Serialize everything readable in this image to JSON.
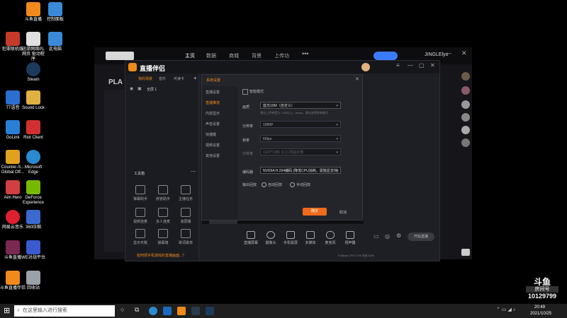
{
  "desktop": {
    "icons_left": [
      {
        "label": "",
        "color": "#f08a1c"
      },
      {
        "label": "犯罪联机版",
        "color": "#c53a2a"
      },
      {
        "label": "Steam",
        "color": "#1b3a5c"
      },
      {
        "label": "TT语音",
        "color": "#2a6fd0"
      },
      {
        "label": "GoLink",
        "color": "#2a7fd8"
      },
      {
        "label": "Counter-S... Global Off...",
        "color": "#e0a020"
      },
      {
        "label": "Aim Hero",
        "color": "#d04040"
      },
      {
        "label": "网易云音乐",
        "color": "#e02030"
      },
      {
        "label": "斗鱼直播",
        "color": "#7a2a50"
      },
      {
        "label": "斗鱼直播伴侣",
        "color": "#f08a1c"
      }
    ],
    "icons_right": [
      {
        "label": "控制面板",
        "color": "#3a8ad8"
      },
      {
        "label": "迅游网络PL网页 驱动程序",
        "color": "#e0e0e0"
      },
      {
        "label": "此电脑",
        "color": "#3a8ad8"
      },
      {
        "label": "Sound Lock",
        "color": "#e0b040"
      },
      {
        "label": "Riot Client",
        "color": "#d03030"
      },
      {
        "label": "Microsoft Edge",
        "color": "#2a8ad0"
      },
      {
        "label": "GeForce Experience",
        "color": "#76b900"
      },
      {
        "label": "360压缩",
        "color": "#3a6ad0"
      },
      {
        "label": "WE对战平台",
        "color": "#3a5ad0"
      },
      {
        "label": "回收站",
        "color": "#9aa0a8"
      }
    ],
    "top_left_label": "斗鱼直播"
  },
  "taskbar": {
    "search_placeholder": "在这里输入进行搜索",
    "time": "20:49",
    "date": "2021/10/25"
  },
  "watermark": {
    "brand": "斗鱼",
    "subtitle": "房间号",
    "room": "10129799"
  },
  "back_window": {
    "nav": [
      "主页",
      "数据",
      "商城",
      "背景",
      "上传功"
    ],
    "user": "JINGLElyo",
    "play_label": "PLA",
    "accent": "#3a7bff"
  },
  "studio": {
    "logo": "直播伴侣",
    "tabs": [
      "我的场景",
      "音乐",
      "可读卡"
    ],
    "scene_item": "全屏 1",
    "tools_header": "工具箱",
    "tools": [
      "弹幕助手",
      "房管助手",
      "主播任务",
      "视频连麦",
      "多人连麦",
      "滚屏播",
      "显示天赋",
      "弹幕墙",
      "歌词歌单"
    ],
    "footer_tip": "如何把手机游戏的直播画面...?",
    "bottom_buttons": [
      "直播屏幕",
      "摄像头",
      "手机投屏",
      "多媒体",
      "麦克风",
      "扬声器"
    ],
    "start_button": "开始直播",
    "status_text": "0.0kbps  CPU 17%  内存 62%"
  },
  "dialog": {
    "title": "系统设置",
    "sidebar": [
      "直播设置",
      "直播推流",
      "内容显示",
      "声音设置",
      "快捷键",
      "视频设置",
      "其他设置"
    ],
    "checkbox_label": "智能模式",
    "rows": [
      {
        "label": "画质",
        "value": "蓝光10M（自定义）"
      },
      {
        "label": "分辨率",
        "value": "1080P"
      },
      {
        "label": "帧率",
        "value": "60fps"
      },
      {
        "label": "分辨率",
        "value": "1920*1080 (1:1) 原始比例"
      },
      {
        "label": "编码器",
        "value": "NVIDIA H.264编码 (降低CPU消耗，需独显支持)"
      }
    ],
    "hint": "建议上传带宽为: 10M以上，Mbps，建议选择智能模式",
    "output_label": "输出回放",
    "radio_a": "自动回放",
    "radio_b": "手动回放",
    "ok": "确定",
    "cancel": "取消",
    "accent": "#f06a1c"
  }
}
